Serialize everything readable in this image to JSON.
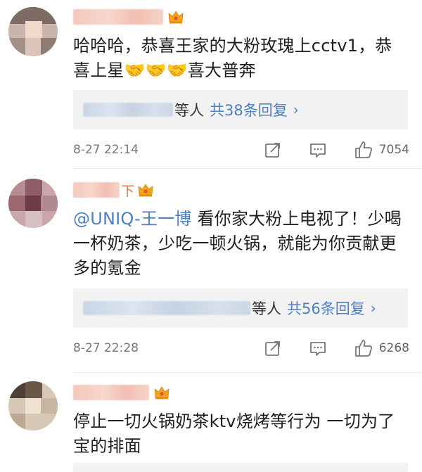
{
  "comments": [
    {
      "name_suffix": "",
      "text": "哈哈哈，恭喜王家的大粉玫瑰上cctv1，恭喜上星🤝🤝🤝喜大普奔",
      "mention": "",
      "reply_people_suffix": "等人",
      "reply_total": "共38条回复",
      "time": "8-27 22:14",
      "likes": "7054"
    },
    {
      "name_suffix": "下",
      "text": " 看你家大粉上电视了！少喝一杯奶茶，少吃一顿火锅，就能为你贡献更多的氪金",
      "mention": "@UNIQ-王一博",
      "reply_people_suffix": "等人",
      "reply_total": "共56条回复",
      "time": "8-27 22:28",
      "likes": "6268"
    },
    {
      "name_suffix": "",
      "text": "停止一切火锅奶茶ktv烧烤等行为 一切为了宝的排面",
      "mention": ""
    }
  ],
  "icons": {
    "crown": "crown-icon",
    "repost": "repost-icon",
    "comment": "comment-icon",
    "like": "thumbs-up-icon",
    "chevron": "chevron-right-icon"
  },
  "colors": {
    "link": "#4d7fc2",
    "crown": "#f0a31b",
    "reply_bg": "#f2f2f2"
  }
}
